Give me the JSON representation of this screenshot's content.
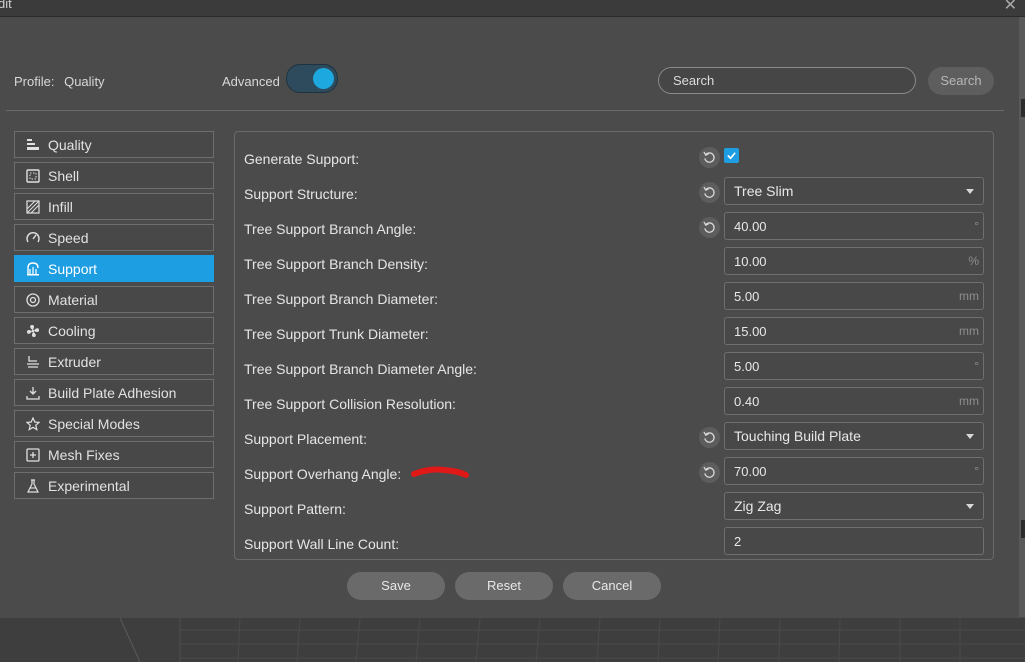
{
  "window": {
    "title": "dit"
  },
  "header": {
    "profile_label": "Profile:",
    "profile_value": "Quality",
    "advanced_label": "Advanced",
    "advanced_on": true,
    "search_placeholder": "Search",
    "search_button": "Search"
  },
  "sidebar": {
    "items": [
      {
        "label": "Quality",
        "icon": "quality-icon",
        "active": false
      },
      {
        "label": "Shell",
        "icon": "shell-icon",
        "active": false
      },
      {
        "label": "Infill",
        "icon": "infill-icon",
        "active": false
      },
      {
        "label": "Speed",
        "icon": "speed-icon",
        "active": false
      },
      {
        "label": "Support",
        "icon": "support-icon",
        "active": true
      },
      {
        "label": "Material",
        "icon": "material-icon",
        "active": false
      },
      {
        "label": "Cooling",
        "icon": "cooling-fan-icon",
        "active": false
      },
      {
        "label": "Extruder",
        "icon": "extruder-icon",
        "active": false
      },
      {
        "label": "Build Plate Adhesion",
        "icon": "build-plate-adhesion-icon",
        "active": false
      },
      {
        "label": "Special Modes",
        "icon": "special-modes-icon",
        "active": false
      },
      {
        "label": "Mesh Fixes",
        "icon": "mesh-fixes-icon",
        "active": false
      },
      {
        "label": "Experimental",
        "icon": "experimental-flask-icon",
        "active": false
      }
    ]
  },
  "settings": {
    "rows": [
      {
        "label": "Generate Support:",
        "type": "checkbox",
        "checked": true,
        "reset": true
      },
      {
        "label": "Support Structure:",
        "type": "select",
        "value": "Tree Slim",
        "reset": true
      },
      {
        "label": "Tree Support Branch Angle:",
        "type": "number",
        "value": "40.00",
        "unit": "°",
        "reset": true
      },
      {
        "label": "Tree Support Branch Density:",
        "type": "number",
        "value": "10.00",
        "unit": "%",
        "reset": false
      },
      {
        "label": "Tree Support Branch Diameter:",
        "type": "number",
        "value": "5.00",
        "unit": "mm",
        "reset": false
      },
      {
        "label": "Tree Support Trunk Diameter:",
        "type": "number",
        "value": "15.00",
        "unit": "mm",
        "reset": false
      },
      {
        "label": "Tree Support Branch Diameter Angle:",
        "type": "number",
        "value": "5.00",
        "unit": "°",
        "reset": false
      },
      {
        "label": "Tree Support Collision Resolution:",
        "type": "number",
        "value": "0.40",
        "unit": "mm",
        "reset": false
      },
      {
        "label": "Support Placement:",
        "type": "select",
        "value": "Touching Build Plate",
        "reset": true
      },
      {
        "label": "Support Overhang Angle:",
        "type": "number",
        "value": "70.00",
        "unit": "°",
        "reset": true
      },
      {
        "label": "Support Pattern:",
        "type": "select",
        "value": "Zig Zag",
        "reset": false
      },
      {
        "label": "Support Wall Line Count:",
        "type": "number",
        "value": "2",
        "unit": "",
        "reset": false
      }
    ]
  },
  "footer": {
    "save": "Save",
    "reset": "Reset",
    "cancel": "Cancel"
  },
  "colors": {
    "accent": "#1d9de2",
    "background": "#4b4b4b",
    "annotation": "#e01818"
  }
}
